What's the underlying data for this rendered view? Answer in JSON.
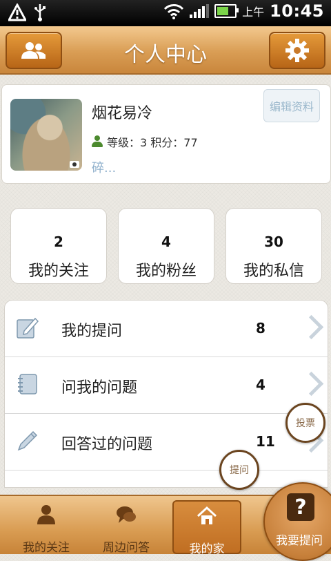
{
  "status_bar": {
    "ampm": "上午",
    "time": "10:45"
  },
  "header": {
    "title": "个人中心",
    "left_icon": "contacts-icon",
    "right_icon": "gear-icon"
  },
  "profile": {
    "username": "烟花易冷",
    "level_text": "等级：3 积分：77",
    "signature": "碎...",
    "edit_label": "编辑资料"
  },
  "stats": [
    {
      "value": "2",
      "label": "我的关注"
    },
    {
      "value": "4",
      "label": "我的粉丝"
    },
    {
      "value": "30",
      "label": "我的私信"
    }
  ],
  "menu": [
    {
      "label": "我的提问",
      "count": "8",
      "icon": "edit-note-icon"
    },
    {
      "label": "问我的问题",
      "count": "4",
      "icon": "notebook-icon"
    },
    {
      "label": "回答过的问题",
      "count": "11",
      "icon": "pencil-icon"
    }
  ],
  "floating": {
    "vote": "投票",
    "ask": "提问"
  },
  "bottom_nav": [
    {
      "label": "我的关注",
      "icon": "person-icon"
    },
    {
      "label": "周边问答",
      "icon": "chat-icon"
    },
    {
      "label": "我的家",
      "icon": "home-icon",
      "active": true
    }
  ],
  "ask_button": {
    "label": "我要提问",
    "icon": "question-icon"
  },
  "colors": {
    "accent": "#d99d54",
    "link": "#8fb0cc"
  }
}
